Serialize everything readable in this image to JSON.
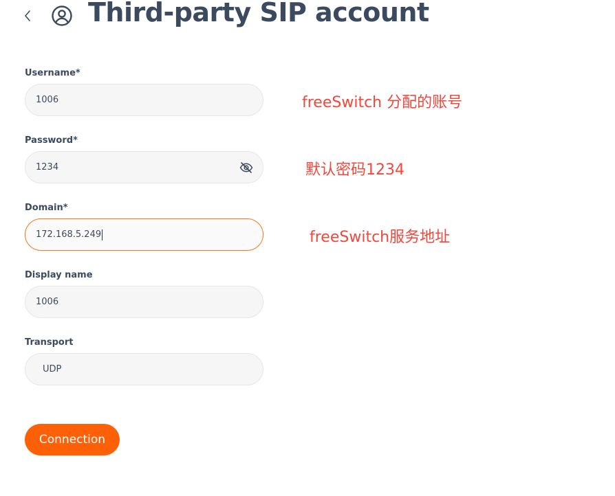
{
  "header": {
    "title": "Third-party SIP account",
    "back_icon": "chevron-left-icon",
    "account_icon": "user-circle-icon"
  },
  "form": {
    "username": {
      "label": "Username*",
      "value": "1006"
    },
    "password": {
      "label": "Password*",
      "value": "1234",
      "toggle_icon": "eye-off-icon"
    },
    "domain": {
      "label": "Domain*",
      "value": "172.168.5.249"
    },
    "display_name": {
      "label": "Display name",
      "value": "1006"
    },
    "transport": {
      "label": "Transport",
      "value": "UDP"
    },
    "connect_label": "Connection"
  },
  "annotations": {
    "username_note": "freeSwitch 分配的账号",
    "password_note": "默认密码1234",
    "domain_note": "freeSwitch服务地址"
  },
  "colors": {
    "title": "#3b4a5e",
    "accent": "#fe6008",
    "focus_border": "#f27a1a",
    "annotation": "#f2473b",
    "input_bg": "#f6f6f6"
  }
}
